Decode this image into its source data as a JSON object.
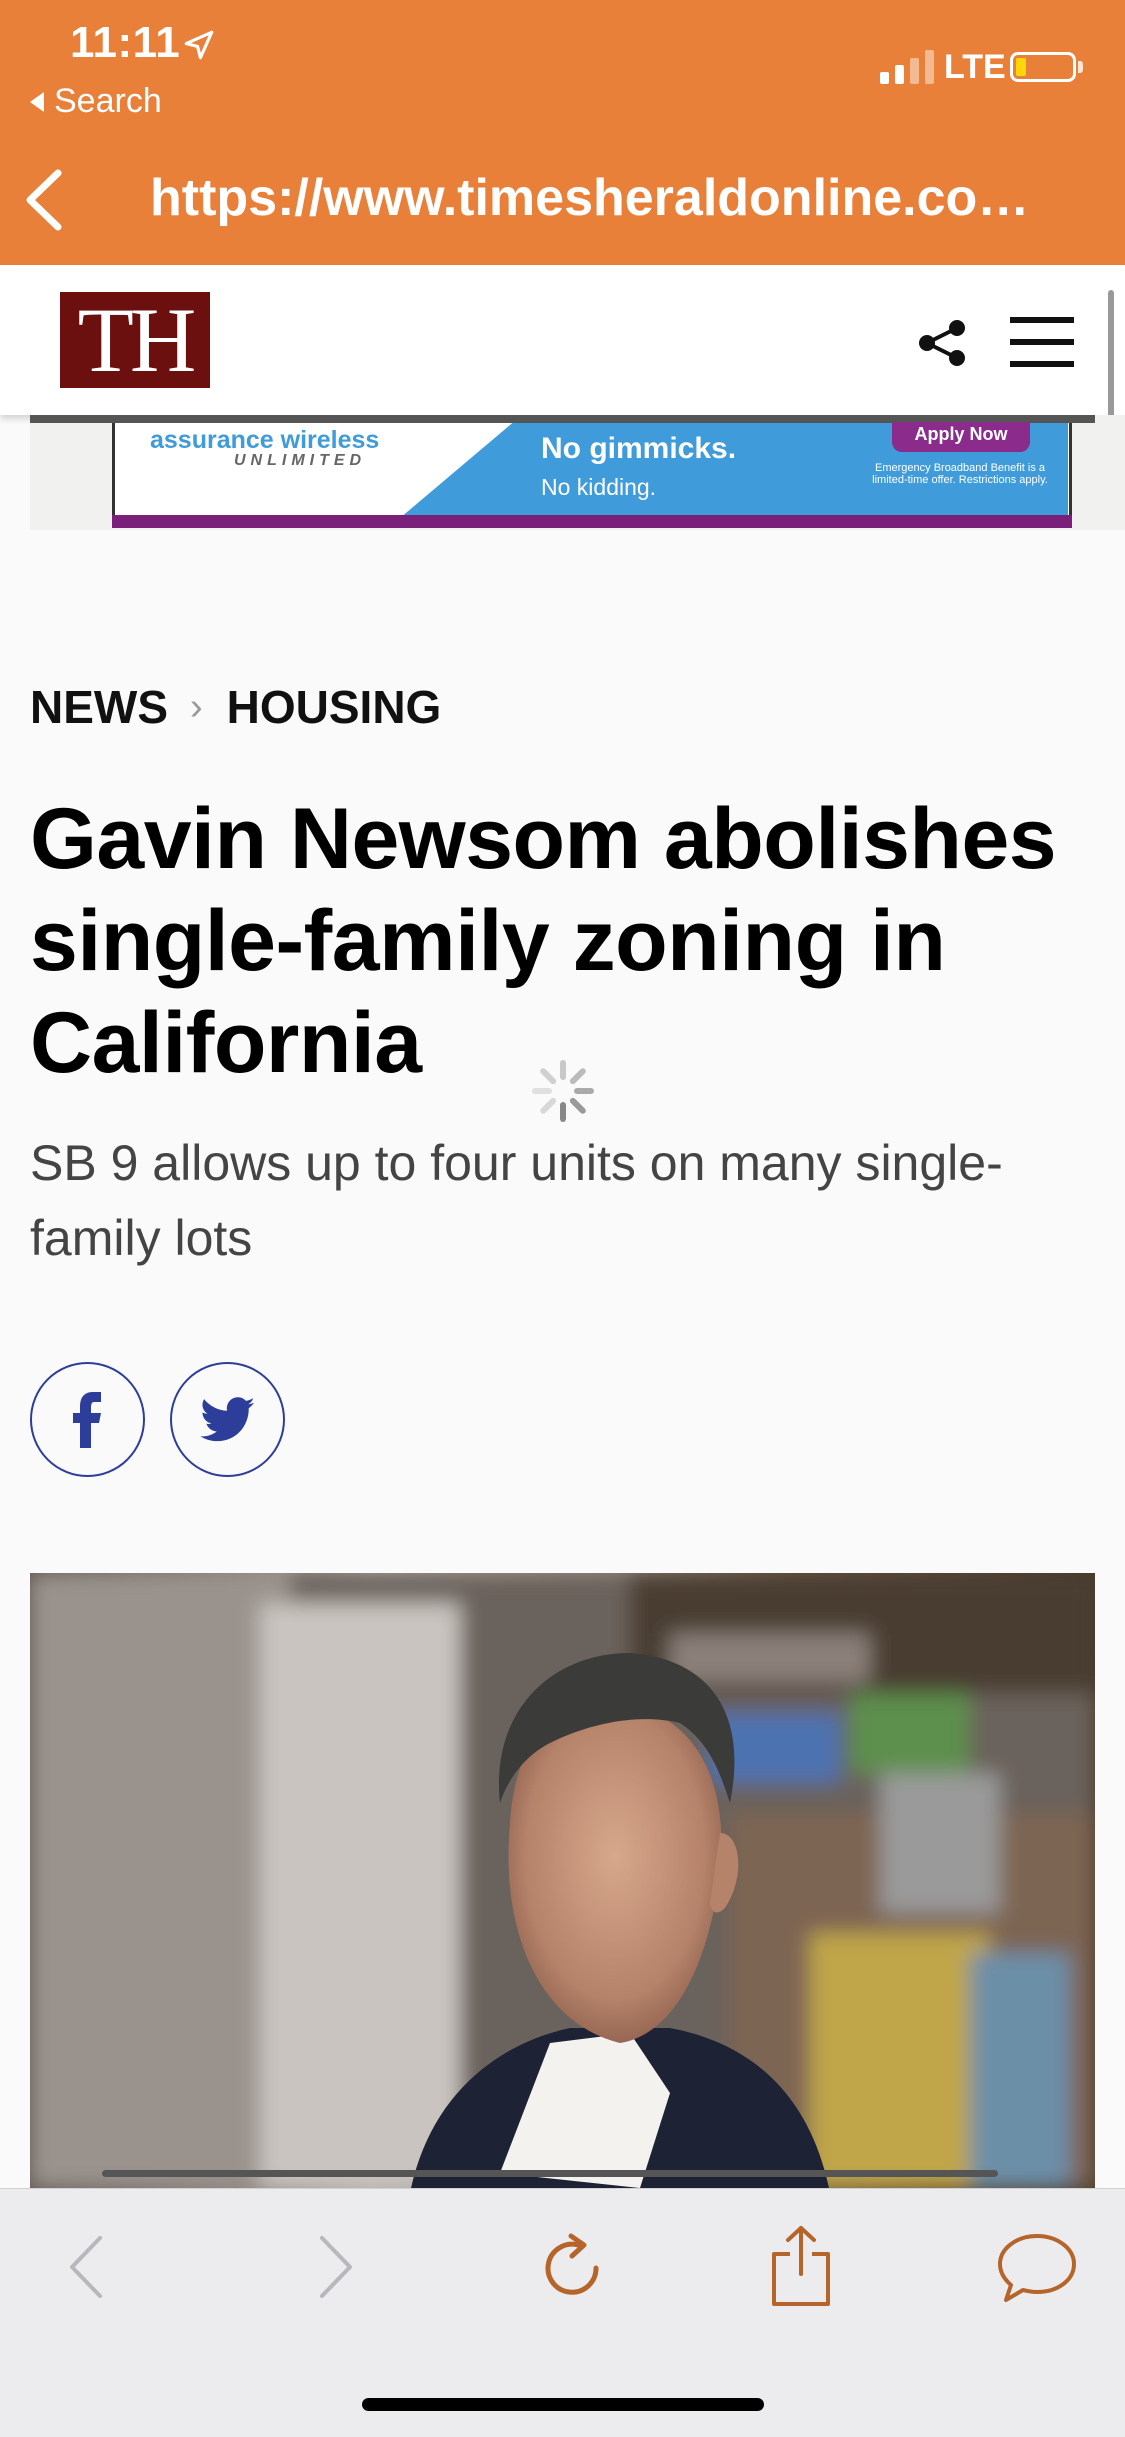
{
  "status_bar": {
    "time": "11:11",
    "back_app_label": "Search",
    "network": "LTE",
    "location_icon": "location-arrow-icon",
    "battery_icon": "battery-low-icon"
  },
  "browser": {
    "url": "https://www.timesheraldonline.co…",
    "toolbar_icons": [
      "back-icon",
      "forward-icon",
      "reload-icon",
      "share-icon",
      "comment-icon"
    ]
  },
  "site": {
    "logo_text": "TH",
    "header_icons": [
      "share-icon",
      "hamburger-menu-icon"
    ]
  },
  "ad": {
    "brand": "assurance wireless",
    "tagline": "UNLIMITED",
    "headline": "No gimmicks.",
    "sub": "No kidding.",
    "cta": "Apply Now",
    "fine_print": "Emergency Broadband Benefit is a limited-time offer. Restrictions apply."
  },
  "article": {
    "breadcrumb": [
      "NEWS",
      "HOUSING"
    ],
    "headline": "Gavin Newsom abolishes single-family zoning in California",
    "subhead": "SB 9 allows up to four units on many single-family lots",
    "social_buttons": [
      "facebook-icon",
      "twitter-icon"
    ]
  },
  "colors": {
    "browser_accent": "#e9803a",
    "logo_bg": "#6b0f0f",
    "social_blue": "#2d3e9a",
    "toolbar_icon": "#b5652a"
  }
}
